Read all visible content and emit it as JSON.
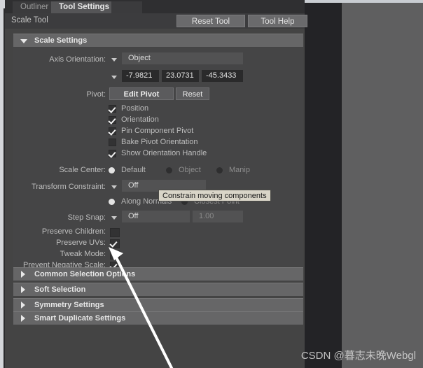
{
  "window": {
    "tabs": [
      {
        "label": "Outliner",
        "active": false
      },
      {
        "label": "Tool Settings",
        "active": true
      }
    ],
    "tool_title": "Scale Tool",
    "buttons": {
      "reset_tool": "Reset Tool",
      "tool_help": "Tool Help"
    }
  },
  "scale_settings": {
    "header": "Scale Settings",
    "axis_orientation": {
      "label": "Axis Orientation:",
      "value": "Object"
    },
    "orientation_values": [
      "-7.9821",
      "23.0731",
      "-45.3433"
    ],
    "pivot": {
      "label": "Pivot:",
      "edit_button": "Edit Pivot",
      "reset_button": "Reset"
    },
    "pivot_checkboxes": [
      {
        "label": "Position",
        "checked": true
      },
      {
        "label": "Orientation",
        "checked": true
      },
      {
        "label": "Pin Component Pivot",
        "checked": true
      },
      {
        "label": "Bake Pivot Orientation",
        "checked": false
      },
      {
        "label": "Show Orientation Handle",
        "checked": true
      }
    ],
    "scale_center": {
      "label": "Scale Center:",
      "options": [
        {
          "label": "Default",
          "selected": true
        },
        {
          "label": "Object",
          "selected": false
        },
        {
          "label": "Manip",
          "selected": false
        }
      ]
    },
    "transform_constraint": {
      "label": "Transform Constraint:",
      "value": "Off",
      "options": [
        {
          "label": "Along Normals",
          "selected": true
        },
        {
          "label": "Closest Point",
          "selected": false
        }
      ]
    },
    "step_snap": {
      "label": "Step Snap:",
      "value": "Off",
      "amount": "1.00"
    },
    "bottom_checkboxes": [
      {
        "label": "Preserve Children:",
        "checked": false
      },
      {
        "label": "Preserve UVs:",
        "checked": true
      },
      {
        "label": "Tweak Mode:",
        "checked": false
      },
      {
        "label": "Prevent Negative Scale:",
        "checked": true
      }
    ]
  },
  "collapsed_sections": [
    {
      "label": "Common Selection Options"
    },
    {
      "label": "Soft Selection"
    },
    {
      "label": "Symmetry Settings"
    },
    {
      "label": "Smart Duplicate Settings"
    }
  ],
  "tooltip": {
    "text": "Constrain moving components"
  },
  "watermark": {
    "text": "CSDN @暮志未晚Webgl"
  }
}
